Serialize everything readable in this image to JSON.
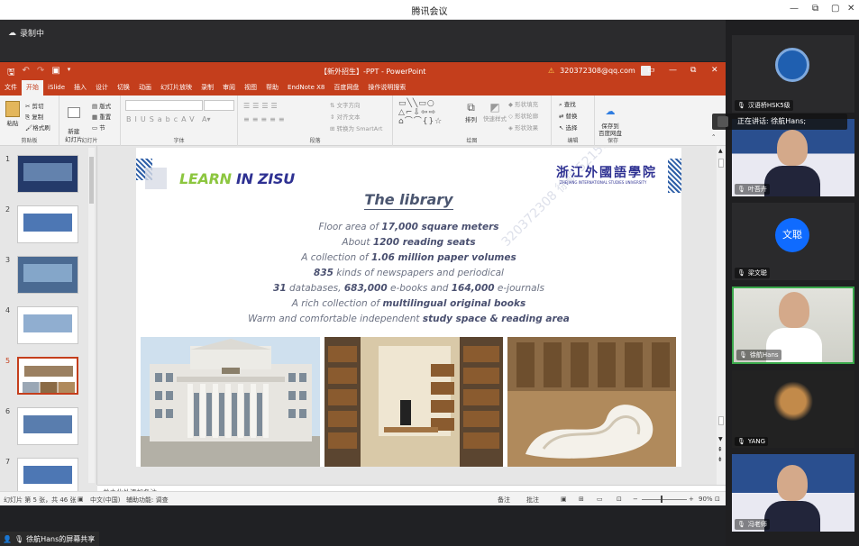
{
  "app": {
    "title": "腾讯会议"
  },
  "meeting": {
    "recording": "录制中",
    "share_label": "徐航Hans的屏幕共享",
    "speaking": "正在讲话: 徐航Hans;"
  },
  "ppt": {
    "doc_title": "【新外招生】-PPT  -  PowerPoint",
    "account": "320372308@qq.com",
    "menu": [
      "文件",
      "开始",
      "iSlide",
      "插入",
      "设计",
      "切换",
      "动画",
      "幻灯片放映",
      "录制",
      "审阅",
      "视图",
      "帮助",
      "EndNote X8",
      "百度网盘",
      "操作说明搜索"
    ],
    "active_tab": "开始",
    "ribbon": {
      "clipboard": {
        "paste": "粘贴",
        "cut": "剪切",
        "copy": "复制",
        "painter": "格式刷",
        "label": "剪贴板"
      },
      "slides": {
        "new": "新建\n幻灯片",
        "layout": "版式",
        "reset": "重置",
        "section": "节",
        "label": "幻灯片"
      },
      "font": {
        "label": "字体"
      },
      "paragraph": {
        "textdir": "文字方向",
        "align": "对齐文本",
        "smartart": "转换为 SmartArt",
        "label": "段落"
      },
      "drawing": {
        "arrange": "排列",
        "quickstyle": "快速样式",
        "fill": "形状填充",
        "outline": "形状轮廓",
        "effect": "形状效果",
        "label": "绘图"
      },
      "editing": {
        "find": "查找",
        "replace": "替换",
        "select": "选择",
        "label": "编辑"
      },
      "save": {
        "btn": "保存到\n百度网盘",
        "label": "保存"
      }
    },
    "thumbs": [
      "1",
      "2",
      "3",
      "4",
      "5",
      "6",
      "7"
    ],
    "selected_slide": 5,
    "notes_placeholder": "单击此处添加备注",
    "status": {
      "slide": "幻灯片 第 5 张，共 46 张",
      "lang": "中文(中国)",
      "access": "辅助功能: 调查",
      "notes": "备注",
      "comments": "批注",
      "zoom": "90%"
    }
  },
  "slide": {
    "learn_a": "LEARN",
    "learn_b": " IN ZISU",
    "title": "The library",
    "logo_cn": "浙江外國語學院",
    "logo_en": "ZHEJIANG INTERNATIONAL STUDIES UNIVERSITY",
    "watermark": "320372308 徐航 52158109",
    "facts": [
      [
        "Floor area of ",
        "17,000 square meters",
        ""
      ],
      [
        "About ",
        "1200 reading seats",
        ""
      ],
      [
        "A collection of ",
        "1.06 million paper volumes",
        ""
      ],
      [
        "",
        "835",
        " kinds of newspapers and periodical"
      ],
      [
        "",
        "31",
        " databases, "
      ],
      [
        "A rich collection of ",
        "multilingual original books",
        ""
      ],
      [
        "Warm and comfortable independent ",
        "study space & reading area",
        ""
      ]
    ],
    "fact5": {
      "a": "31",
      "b": " databases, ",
      "c": "683,000",
      "d": " e-books and ",
      "e": "164,000",
      "f": " e-journals"
    }
  },
  "participants": [
    {
      "name": "汉语桥HSK5级",
      "kind": "logo"
    },
    {
      "name": "叶吾卉",
      "kind": "video"
    },
    {
      "name": "梁文聪",
      "kind": "avatar",
      "avatar_text": "文聪"
    },
    {
      "name": "徐航Hans",
      "kind": "video",
      "active": true
    },
    {
      "name": "YANG",
      "kind": "video"
    },
    {
      "name": "冯老师",
      "kind": "video"
    }
  ],
  "colors": {
    "ppt_red": "#c43e1c",
    "green_lead": "#8cc63f",
    "zisu_blue": "#2e3192",
    "meeting_blue": "#0f6bff"
  }
}
